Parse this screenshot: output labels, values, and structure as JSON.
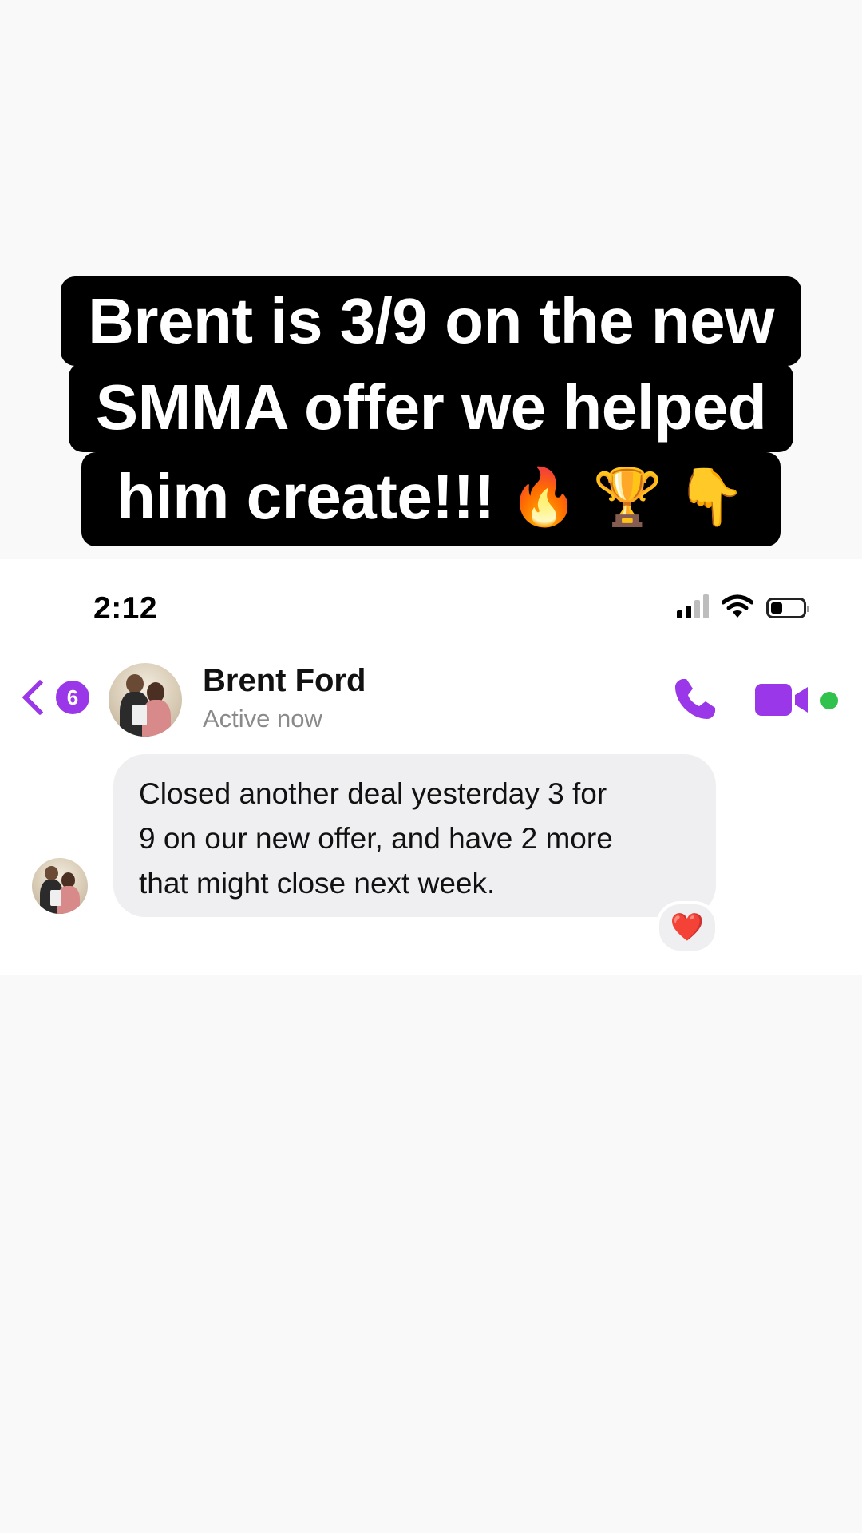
{
  "caption": {
    "line1": "Brent is 3/9 on the new",
    "line2": "SMMA offer we helped",
    "line3": "him create!!!",
    "emojis": [
      "🔥",
      "🏆",
      "👇"
    ]
  },
  "status_bar": {
    "time": "2:12"
  },
  "header": {
    "back_badge": "6",
    "contact_name": "Brent Ford",
    "contact_status": "Active now"
  },
  "message": {
    "lines": [
      "Closed another deal yesterday 3 for",
      "9 on our new offer, and have 2 more",
      "that might close next week."
    ],
    "reaction": "❤️"
  },
  "colors": {
    "accent": "#9a37e8",
    "online": "#31c24d",
    "bubble": "#efeff1"
  }
}
